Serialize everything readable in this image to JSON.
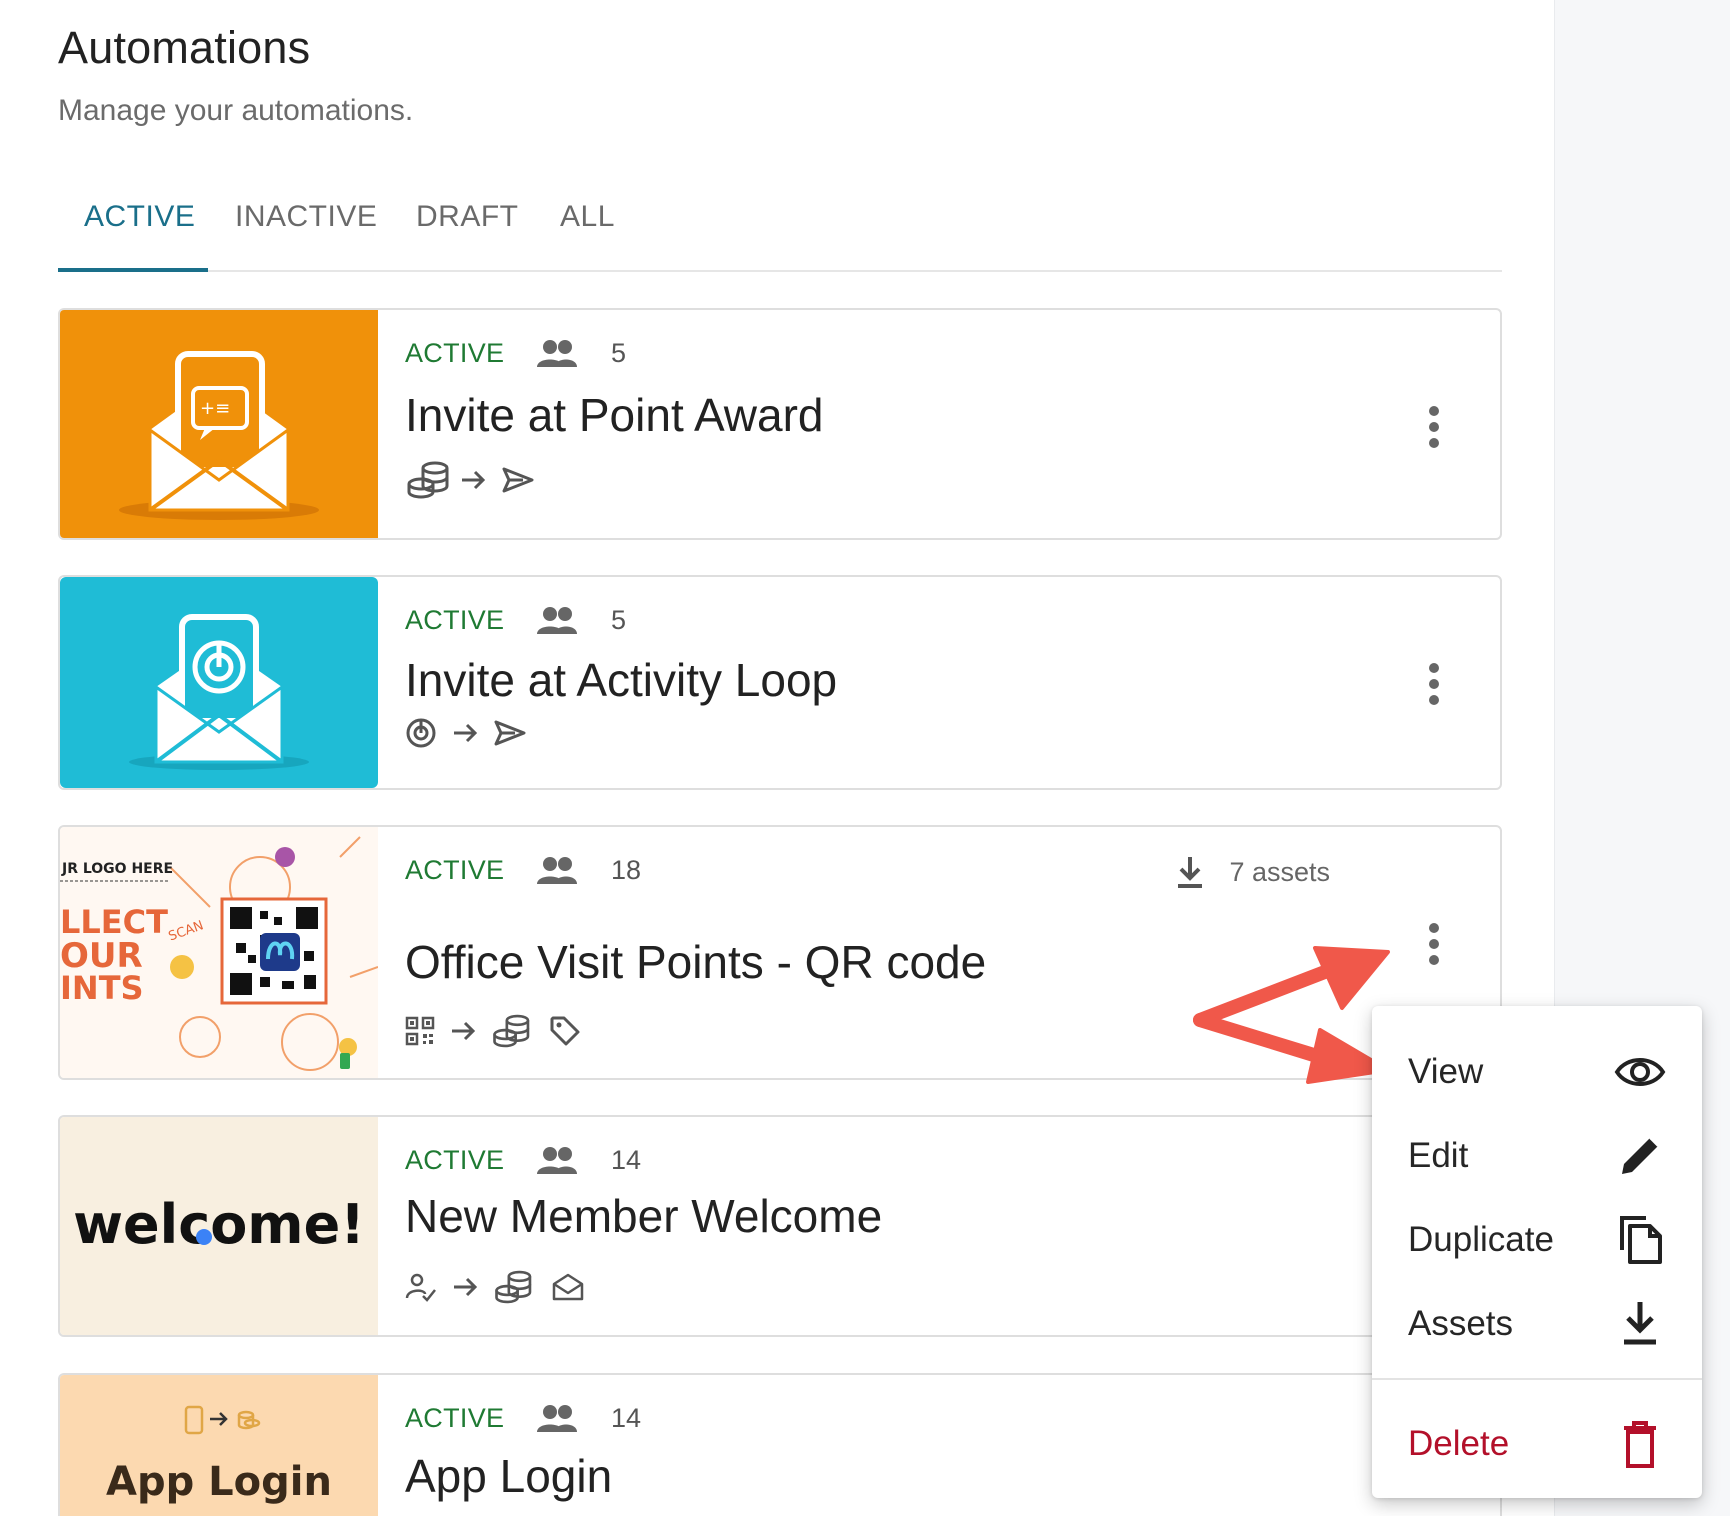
{
  "header": {
    "title": "Automations",
    "subtitle": "Manage your automations."
  },
  "tabs": [
    {
      "label": "ACTIVE",
      "selected": true
    },
    {
      "label": "INACTIVE",
      "selected": false
    },
    {
      "label": "DRAFT",
      "selected": false
    },
    {
      "label": "ALL",
      "selected": false
    }
  ],
  "automations": [
    {
      "status": "ACTIVE",
      "count": "5",
      "title": "Invite at Point Award",
      "thumb_color": "#f0910a",
      "flow_icons": [
        "coins-icon",
        "arrow-right-icon",
        "send-icon"
      ]
    },
    {
      "status": "ACTIVE",
      "count": "5",
      "title": "Invite at Activity Loop",
      "thumb_color": "#1fbcd6",
      "flow_icons": [
        "activity-loop-icon",
        "arrow-right-icon",
        "send-icon"
      ]
    },
    {
      "status": "ACTIVE",
      "count": "18",
      "title": "Office Visit Points - QR code",
      "assets_label": "7 assets",
      "thumb_text": {
        "logo": "JR LOGO HERE",
        "line1": "LLECT",
        "line2": "OUR",
        "line3": "INTS",
        "scan": "SCAN"
      },
      "flow_icons": [
        "qr-code-icon",
        "arrow-right-icon",
        "coins-icon",
        "tag-icon"
      ]
    },
    {
      "status": "ACTIVE",
      "count": "14",
      "title": "New Member Welcome",
      "thumb_text": "welcome!",
      "thumb_color": "#f8efe0",
      "flow_icons": [
        "user-check-icon",
        "arrow-right-icon",
        "coins-icon",
        "mail-open-icon"
      ]
    },
    {
      "status": "ACTIVE",
      "count": "14",
      "title": "App Login",
      "thumb_text": "App Login",
      "thumb_color": "#fcd9b0",
      "flow_icons": []
    }
  ],
  "context_menu": {
    "items": [
      {
        "label": "View",
        "icon": "eye-icon"
      },
      {
        "label": "Edit",
        "icon": "pencil-icon"
      },
      {
        "label": "Duplicate",
        "icon": "copy-icon"
      },
      {
        "label": "Assets",
        "icon": "download-icon"
      },
      {
        "label": "Delete",
        "icon": "trash-icon",
        "color": "#b3102a"
      }
    ]
  },
  "colors": {
    "accent": "#1a6f8a",
    "status_active": "#1f7a33",
    "annotation_arrow": "#f0584a"
  }
}
